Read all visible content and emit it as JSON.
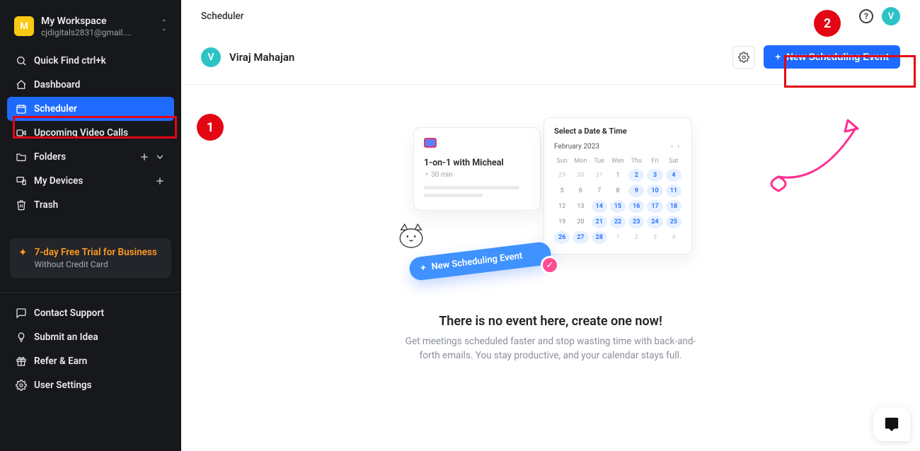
{
  "colors": {
    "accent": "#1f6bff",
    "annotation": "#e30613",
    "accentArrow": "#ff2e92",
    "teal": "#2cc3c6"
  },
  "workspace": {
    "avatar_initial": "M",
    "name": "My Workspace",
    "email": "cjdigitals2831@gmail...."
  },
  "sidebar": {
    "quick_find": "Quick Find ctrl+k",
    "items": [
      {
        "icon": "home-icon",
        "label": "Dashboard"
      },
      {
        "icon": "calendar-icon",
        "label": "Scheduler"
      },
      {
        "icon": "video-icon",
        "label": "Upcoming Video Calls"
      },
      {
        "icon": "folder-icon",
        "label": "Folders"
      },
      {
        "icon": "devices-icon",
        "label": "My Devices"
      },
      {
        "icon": "trash-icon",
        "label": "Trash"
      }
    ],
    "trial": {
      "title": "7-day Free Trial for Business",
      "subtitle": "Without Credit Card"
    },
    "footer": [
      {
        "icon": "support-icon",
        "label": "Contact Support"
      },
      {
        "icon": "idea-icon",
        "label": "Submit an Idea"
      },
      {
        "icon": "gift-icon",
        "label": "Refer & Earn"
      },
      {
        "icon": "settings-icon",
        "label": "User Settings"
      }
    ]
  },
  "header": {
    "breadcrumb": "Scheduler",
    "avatar_initial": "V"
  },
  "panel": {
    "avatar_initial": "V",
    "user_name": "Viraj Mahajan",
    "new_event_label": "New Scheduling Event"
  },
  "empty": {
    "title": "There is no event here, create one now!",
    "subtitle": "Get meetings scheduled faster and stop wasting time with back-and-forth emails. You stay productive, and your calendar stays full.",
    "illus": {
      "left_title": "1-on-1 with Micheal",
      "left_duration": "30 min",
      "right_title": "Select a Date & Time",
      "right_month": "February 2023",
      "pill_label": "New Scheduling Event",
      "weekday_labels": [
        "Sun",
        "Mon",
        "Tue",
        "Wen",
        "Thu",
        "Fri",
        "Sat"
      ],
      "days": [
        {
          "n": 29,
          "dim": true
        },
        {
          "n": 30,
          "dim": true
        },
        {
          "n": 31,
          "dim": true
        },
        {
          "n": 1
        },
        {
          "n": 2,
          "avail": true
        },
        {
          "n": 3,
          "avail": true
        },
        {
          "n": 4,
          "avail": true
        },
        {
          "n": 5
        },
        {
          "n": 6
        },
        {
          "n": 7
        },
        {
          "n": 8
        },
        {
          "n": 9,
          "avail": true
        },
        {
          "n": 10,
          "avail": true
        },
        {
          "n": 11,
          "avail": true
        },
        {
          "n": 12
        },
        {
          "n": 13
        },
        {
          "n": 14,
          "avail": true
        },
        {
          "n": 15,
          "avail": true
        },
        {
          "n": 16,
          "avail": true
        },
        {
          "n": 17,
          "avail": true
        },
        {
          "n": 18,
          "avail": true
        },
        {
          "n": 19
        },
        {
          "n": 20
        },
        {
          "n": 21,
          "avail": true
        },
        {
          "n": 22,
          "avail": true
        },
        {
          "n": 23,
          "avail": true
        },
        {
          "n": 24,
          "avail": true
        },
        {
          "n": 25,
          "avail": true
        },
        {
          "n": 26,
          "avail": true
        },
        {
          "n": 27,
          "avail": true
        },
        {
          "n": 28,
          "avail": true
        },
        {
          "n": 1,
          "dim": true
        },
        {
          "n": 2,
          "dim": true
        },
        {
          "n": 3,
          "dim": true
        },
        {
          "n": 4,
          "dim": true
        }
      ]
    }
  },
  "annotations": {
    "one": "1",
    "two": "2"
  }
}
